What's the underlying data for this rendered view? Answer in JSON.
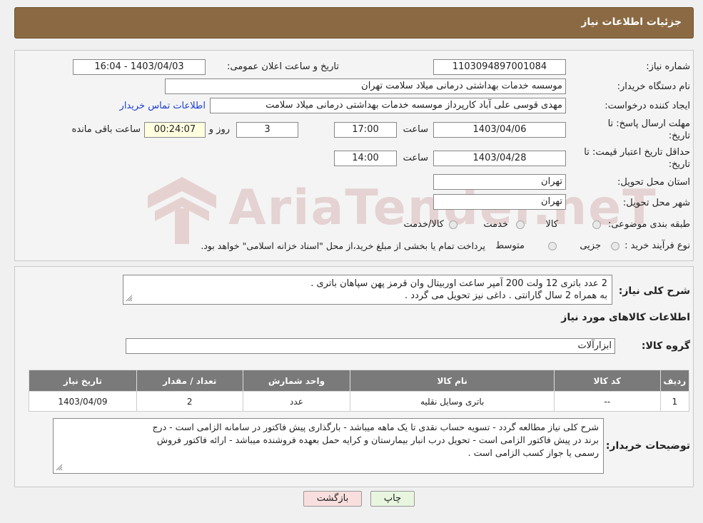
{
  "header": {
    "title": "جزئیات اطلاعات نیاز"
  },
  "form": {
    "need_number_label": "شماره نیاز:",
    "need_number": "1103094897001084",
    "announce_label": "تاریخ و ساعت اعلان عمومی:",
    "announce_value": "1403/04/03 - 16:04",
    "buyer_org_label": "نام دستگاه خریدار:",
    "buyer_org": "موسسه خدمات بهداشتی درمانی میلاد سلامت تهران",
    "creator_label": "ایجاد کننده درخواست:",
    "creator": "مهدی قوسی علی آباد کارپرداز موسسه خدمات بهداشتی درمانی میلاد سلامت",
    "contact_link": "اطلاعات تماس خریدار",
    "deadline_label_1": "مهلت ارسال پاسخ: تا",
    "deadline_label_2": "تاریخ:",
    "deadline_date": "1403/04/06",
    "time_label": "ساعت",
    "deadline_time": "17:00",
    "days_value": "3",
    "days_label": "روز و",
    "remaining_value": "00:24:07",
    "remaining_label": "ساعت باقی مانده",
    "validity_label_1": "حداقل تاریخ اعتبار قیمت: تا",
    "validity_label_2": "تاریخ:",
    "validity_date": "1403/04/28",
    "validity_time": "14:00",
    "province_label": "استان محل تحویل:",
    "province": "تهران",
    "city_label": "شهر محل تحویل:",
    "city": "تهران",
    "category_label": "طبقه بندی موضوعی:",
    "category_options": [
      "کالا",
      "خدمت",
      "کالا/خدمت"
    ],
    "purchase_type_label": "نوع فرآیند خرید :",
    "purchase_options": [
      "جزیی",
      "متوسط"
    ],
    "purchase_note": "پرداخت تمام یا بخشی از مبلغ خرید،از محل \"اسناد خزانه اسلامی\" خواهد بود."
  },
  "summary": {
    "label": "شرح کلی نیاز:",
    "line1": "2 عدد باتری 12 ولت 200 آمپر ساعت اوربیتال وان قرمز پهن سپاهان باتری .",
    "line2": "به همراه 2 سال گارانتی . داغی نیز تحویل می گردد ."
  },
  "goods": {
    "section_title": "اطلاعات کالاهای مورد نیاز",
    "group_label": "گروه کالا:",
    "group_value": "ابزارآلات"
  },
  "table": {
    "headers": [
      "ردیف",
      "کد کالا",
      "نام کالا",
      "واحد شمارش",
      "تعداد / مقدار",
      "تاریخ نیاز"
    ],
    "rows": [
      [
        "1",
        "--",
        "باتری وسایل نقلیه",
        "عدد",
        "2",
        "1403/04/09"
      ]
    ]
  },
  "buyer_notes": {
    "label": "توضیحات خریدار:",
    "line1": "شرح کلی نیاز مطالعه گردد - تسویه حساب نقدی تا یک ماهه میباشد - بارگذاری پیش فاکتور در سامانه الزامی است - درج",
    "line2": "برند در پیش فاکتور الزامی است - تحویل درب انبار بیمارستان و کرایه حمل بعهده فروشنده میباشد - ارائه فاکتور فروش",
    "line3": "رسمی یا جواز کسب الزامی است ."
  },
  "buttons": {
    "print": "چاپ",
    "back": "بازگشت"
  },
  "watermark": "AriaTender.neT",
  "colors": {
    "header": "#8b6a43",
    "table_header": "#7a7a7a",
    "link": "#1a3fd0"
  }
}
